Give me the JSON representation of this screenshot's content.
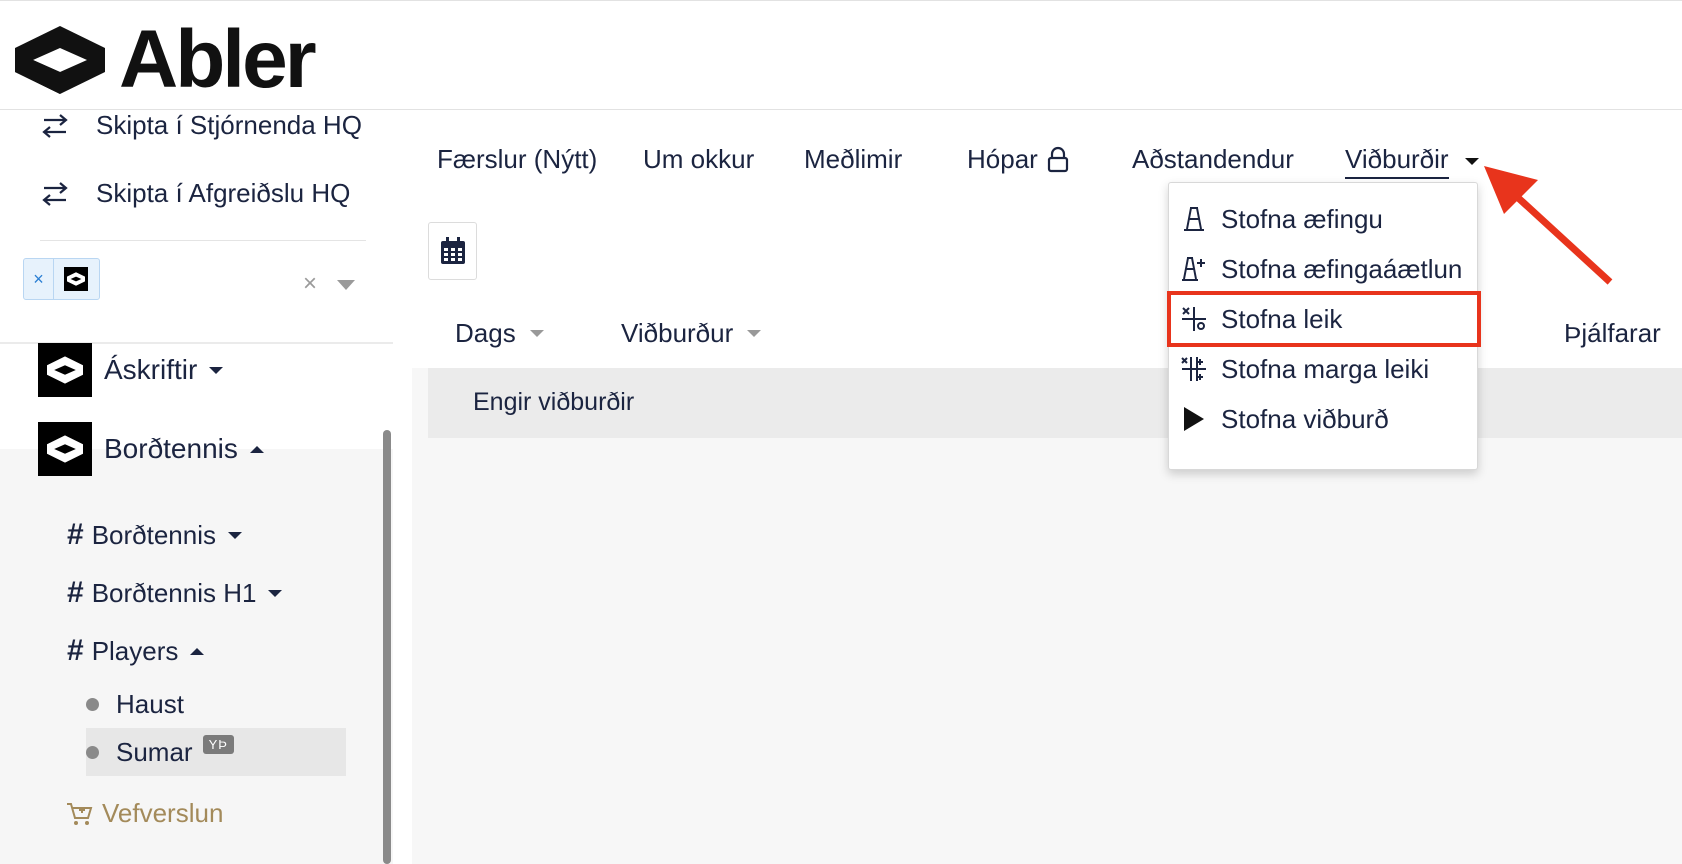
{
  "brand": {
    "name": "Abler"
  },
  "sidebar": {
    "switch_items": [
      {
        "label": "Skipta í Stjórnenda HQ"
      },
      {
        "label": "Skipta í Afgreiðslu HQ"
      }
    ],
    "filter": {
      "chip_remove": "×",
      "clear": "×"
    },
    "groups": [
      {
        "label": "Áskriftir",
        "expanded": false
      },
      {
        "label": "Borðtennis",
        "expanded": true
      }
    ],
    "subgroups": [
      {
        "label": "Borðtennis",
        "expanded": false
      },
      {
        "label": "Borðtennis H1",
        "expanded": false
      },
      {
        "label": "Players",
        "expanded": true
      }
    ],
    "leaves": [
      {
        "label": "Haust",
        "active": false
      },
      {
        "label": "Sumar",
        "active": true,
        "badge": "YÞ"
      }
    ],
    "shop_label": "Vefverslun",
    "colors": {
      "shop": "#a38a5a",
      "text": "#1b2440"
    }
  },
  "main": {
    "tabs": [
      {
        "label": "Færslur (Nýtt)"
      },
      {
        "label": "Um okkur"
      },
      {
        "label": "Meðlimir"
      },
      {
        "label": "Hópar"
      },
      {
        "label": "Aðstandendur"
      },
      {
        "label": "Viðburðir",
        "active": true
      }
    ],
    "columns": [
      {
        "label": "Dags"
      },
      {
        "label": "Viðburður"
      },
      {
        "label": "Þjálfarar"
      }
    ],
    "empty_text": "Engir viðburðir"
  },
  "dropdown": {
    "items": [
      {
        "label": "Stofna æfingu",
        "icon": "cone-icon"
      },
      {
        "label": "Stofna æfingaáætlun",
        "icon": "cone-plus-icon"
      },
      {
        "label": "Stofna leik",
        "icon": "match-icon",
        "highlighted": true
      },
      {
        "label": "Stofna marga leiki",
        "icon": "multi-match-icon"
      },
      {
        "label": "Stofna viðburð",
        "icon": "play-icon"
      }
    ],
    "highlight_color": "#e8341c"
  }
}
